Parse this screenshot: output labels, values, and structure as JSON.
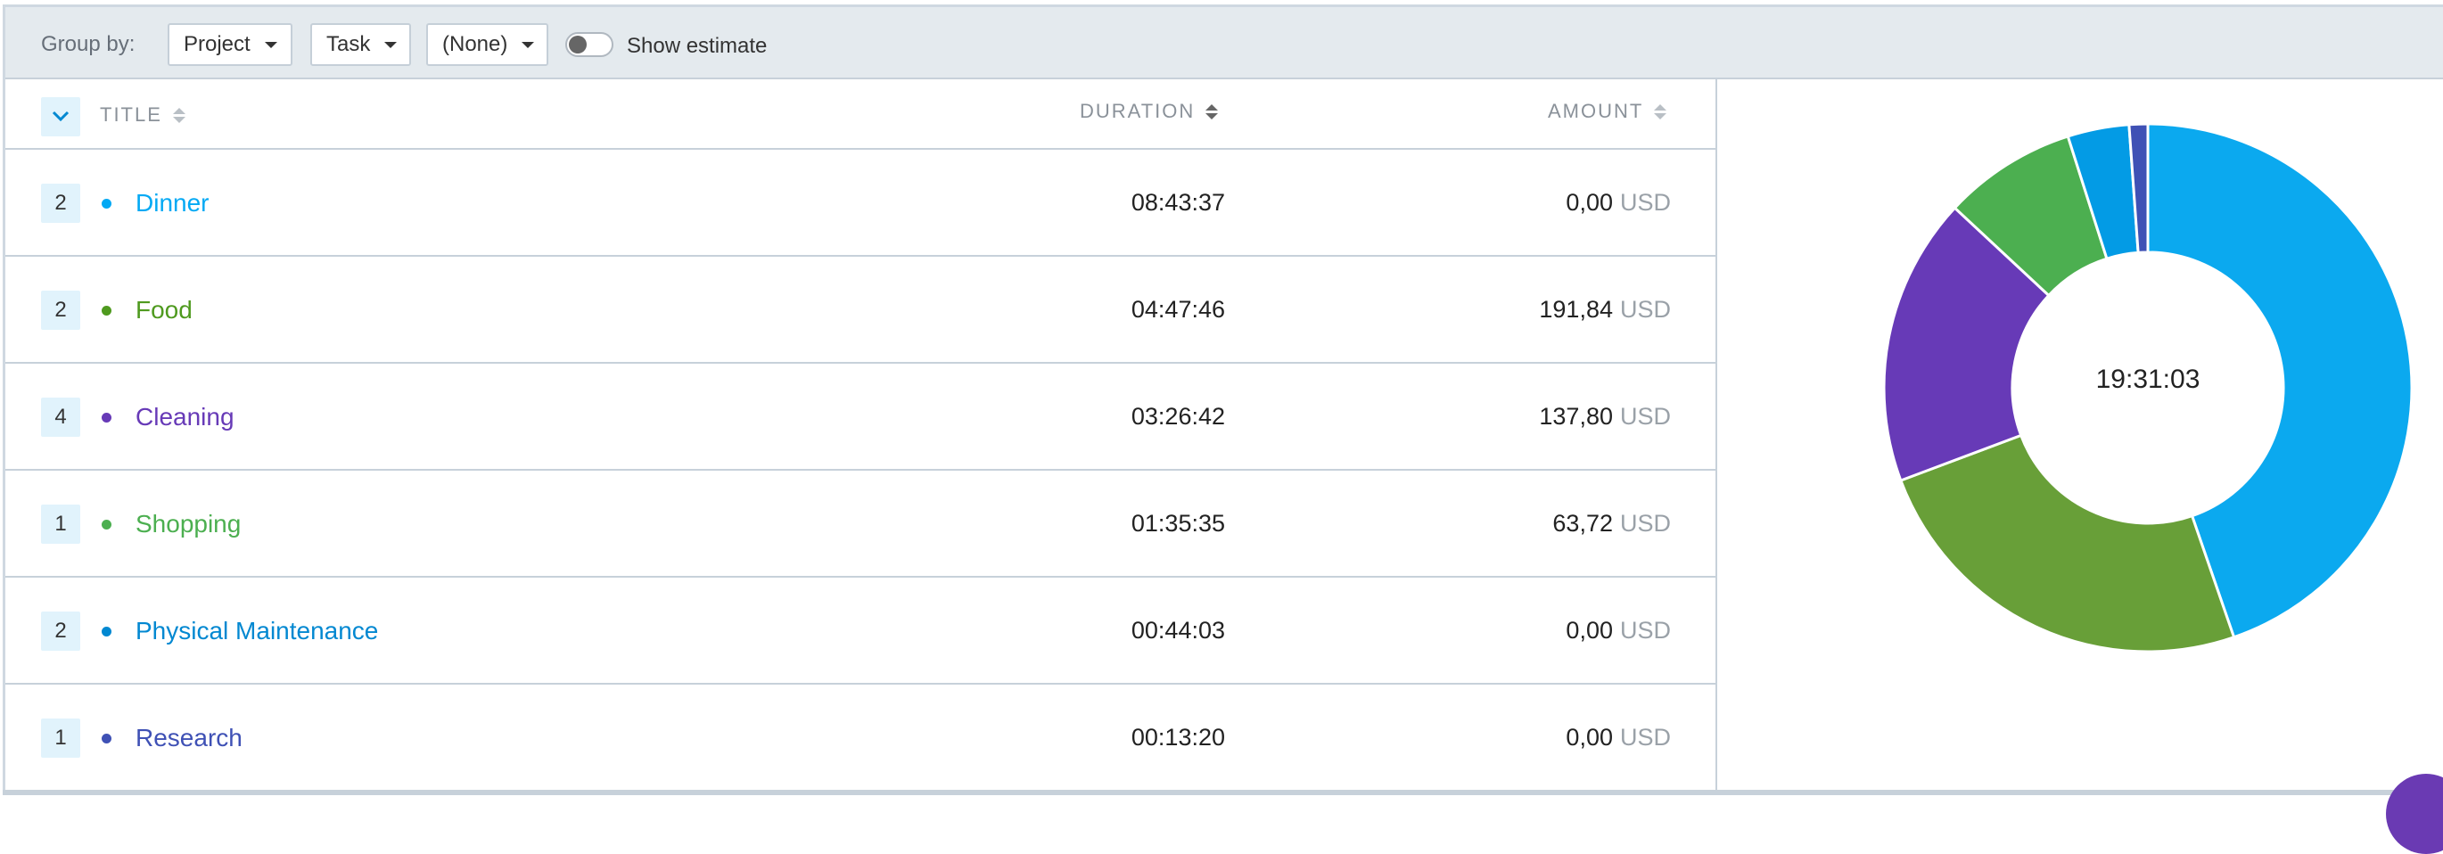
{
  "toolbar": {
    "group_by_label": "Group by:",
    "group_1": "Project",
    "group_2": "Task",
    "group_3": "(None)",
    "show_estimate_label": "Show estimate",
    "show_estimate_on": false
  },
  "table": {
    "columns": {
      "title": "TITLE",
      "duration": "DURATION",
      "amount": "AMOUNT"
    },
    "rows": [
      {
        "count": "2",
        "project": "Dinner",
        "color": "#03a9f4",
        "duration": "08:43:37",
        "amount": "0,00",
        "currency": "USD"
      },
      {
        "count": "2",
        "project": "Food",
        "color": "#4f9a1f",
        "duration": "04:47:46",
        "amount": "191,84",
        "currency": "USD"
      },
      {
        "count": "4",
        "project": "Cleaning",
        "color": "#673ab7",
        "duration": "03:26:42",
        "amount": "137,80",
        "currency": "USD"
      },
      {
        "count": "1",
        "project": "Shopping",
        "color": "#4caf50",
        "duration": "01:35:35",
        "amount": "63,72",
        "currency": "USD"
      },
      {
        "count": "2",
        "project": "Physical Maintenance",
        "color": "#0288d1",
        "duration": "00:44:03",
        "amount": "0,00",
        "currency": "USD"
      },
      {
        "count": "1",
        "project": "Research",
        "color": "#3f51b5",
        "duration": "00:13:20",
        "amount": "0,00",
        "currency": "USD"
      }
    ]
  },
  "donut": {
    "total_label": "19:31:03",
    "slices": [
      {
        "project": "Dinner",
        "seconds": 31417,
        "color": "#0ba9ef"
      },
      {
        "project": "Food",
        "seconds": 17266,
        "color": "#689f38"
      },
      {
        "project": "Cleaning",
        "seconds": 12402,
        "color": "#673ab7"
      },
      {
        "project": "Shopping",
        "seconds": 5735,
        "color": "#4caf50"
      },
      {
        "project": "Physical Maintenance",
        "seconds": 2643,
        "color": "#039be5"
      },
      {
        "project": "Research",
        "seconds": 800,
        "color": "#3f51b5"
      }
    ]
  }
}
